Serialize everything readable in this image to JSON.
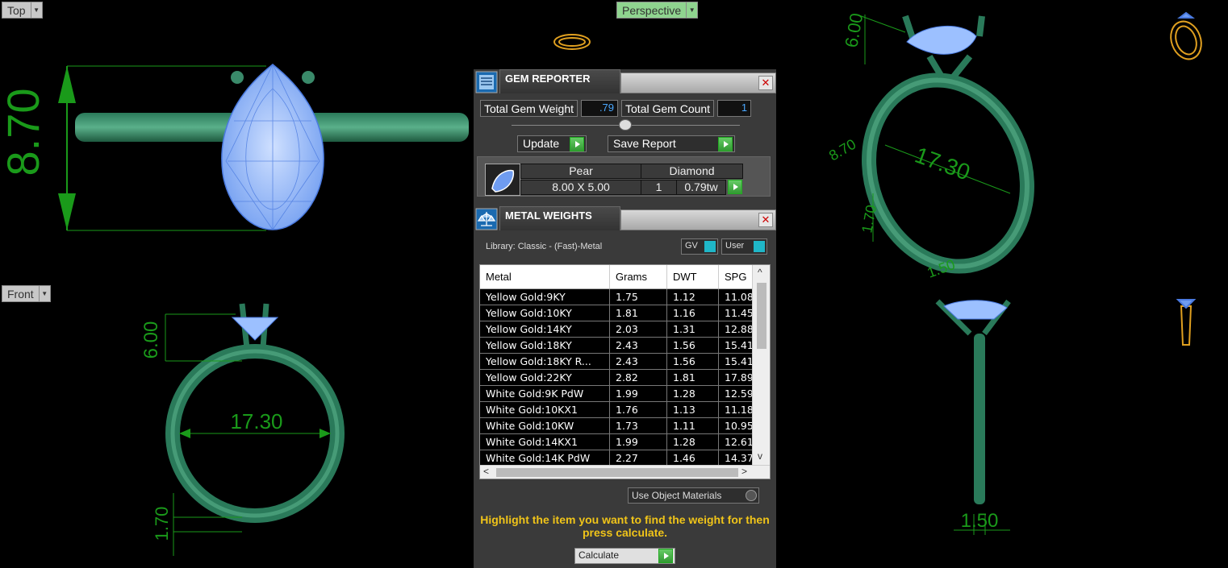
{
  "viewports": {
    "top": {
      "label": "Top",
      "dim_vertical": "8.70"
    },
    "perspective": {
      "label": "Perspective",
      "dims": [
        "6.00",
        "17.30",
        "8.70",
        "1.70",
        "1.50"
      ]
    },
    "front": {
      "label": "Front",
      "dim_top": "6.00",
      "dim_width": "17.30",
      "dim_bottom": "1.70"
    },
    "right": {
      "dim_bottom": "1.50"
    }
  },
  "gem_reporter": {
    "title": "GEM REPORTER",
    "close": "✕",
    "total_weight_label": "Total Gem Weight",
    "total_weight_value": ".79",
    "total_count_label": "Total Gem Count",
    "total_count_value": "1",
    "update_label": "Update",
    "save_label": "Save Report",
    "gem": {
      "shape": "Pear",
      "material": "Diamond",
      "size": "8.00 X 5.00",
      "count": "1",
      "weight": "0.79tw"
    }
  },
  "metal_weights": {
    "title": "METAL WEIGHTS",
    "close": "✕",
    "library": "Library: Classic - (Fast)-Metal",
    "gv_label": "GV",
    "user_label": "User",
    "columns": [
      "Metal",
      "Grams",
      "DWT",
      "SPG"
    ],
    "rows": [
      [
        "Yellow Gold:9KY",
        "1.75",
        "1.12",
        "11.08"
      ],
      [
        "Yellow Gold:10KY",
        "1.81",
        "1.16",
        "11.45"
      ],
      [
        "Yellow Gold:14KY",
        "2.03",
        "1.31",
        "12.88"
      ],
      [
        "Yellow Gold:18KY",
        "2.43",
        "1.56",
        "15.41"
      ],
      [
        "Yellow Gold:18KY R...",
        "2.43",
        "1.56",
        "15.41"
      ],
      [
        "Yellow Gold:22KY",
        "2.82",
        "1.81",
        "17.89"
      ],
      [
        "White Gold:9K PdW",
        "1.99",
        "1.28",
        "12.59"
      ],
      [
        "White Gold:10KX1",
        "1.76",
        "1.13",
        "11.18"
      ],
      [
        "White Gold:10KW",
        "1.73",
        "1.11",
        "10.95"
      ],
      [
        "White Gold:14KX1",
        "1.99",
        "1.28",
        "12.61"
      ],
      [
        "White Gold:14K PdW",
        "2.27",
        "1.46",
        "14.37"
      ]
    ],
    "use_object_materials": "Use Object Materials",
    "hint": "Highlight the item you want to find the weight for then press calculate.",
    "calculate": "Calculate"
  }
}
